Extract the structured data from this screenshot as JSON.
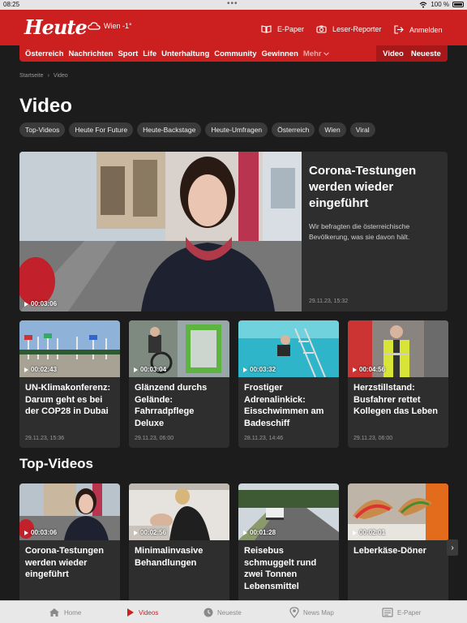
{
  "statusbar": {
    "time": "08:25",
    "battery": "100 %"
  },
  "header": {
    "logo": "Heute",
    "weather": "Wien -1°",
    "epaper": "E-Paper",
    "leser": "Leser-Reporter",
    "anmelden": "Anmelden"
  },
  "nav": {
    "items": [
      "Österreich",
      "Nachrichten",
      "Sport",
      "Life",
      "Unterhaltung",
      "Community",
      "Gewinnen"
    ],
    "more": "Mehr",
    "video": "Video",
    "neueste": "Neueste"
  },
  "breadcrumb": {
    "home": "Startseite",
    "current": "Video"
  },
  "page_title": "Video",
  "chips": [
    "Top-Videos",
    "Heute For Future",
    "Heute-Backstage",
    "Heute-Umfragen",
    "Österreich",
    "Wien",
    "Viral"
  ],
  "hero": {
    "title": "Corona-Testungen werden wieder eingeführt",
    "desc": "Wir befragten die österreichische Bevölkerung, was sie davon hält.",
    "date": "29.11.23, 15:32",
    "duration": "00:03:06"
  },
  "row1": [
    {
      "title": "UN-Klimakonferenz: Darum geht es bei der COP28 in Dubai",
      "date": "29.11.23, 15:36",
      "duration": "00:02:43"
    },
    {
      "title": "Glänzend durchs Gelände: Fahrradpflege Deluxe",
      "date": "29.11.23, 06:00",
      "duration": "00:03:04"
    },
    {
      "title": "Frostiger Adrenalinkick: Eisschwimmen am Badeschiff",
      "date": "28.11.23, 14:46",
      "duration": "00:03:32"
    },
    {
      "title": "Herzstillstand: Busfahrer rettet Kollegen das Leben",
      "date": "29.11.23, 06:00",
      "duration": "00:04:56"
    }
  ],
  "section_top": "Top-Videos",
  "row2": [
    {
      "title": "Corona-Testungen werden wieder eingeführt",
      "duration": "00:03:06"
    },
    {
      "title": "Minimalinvasive Behandlungen",
      "duration": "00:02:56"
    },
    {
      "title": "Reisebus schmuggelt rund zwei Tonnen Lebensmittel",
      "duration": "00:01:28"
    },
    {
      "title": "Leberkäse-Döner",
      "duration": "00:02:01"
    }
  ],
  "tabbar": [
    {
      "label": "Home",
      "icon": "home-icon"
    },
    {
      "label": "Videos",
      "icon": "play-icon"
    },
    {
      "label": "Neueste",
      "icon": "clock-icon"
    },
    {
      "label": "News Map",
      "icon": "map-pin-icon"
    },
    {
      "label": "E-Paper",
      "icon": "newspaper-icon"
    }
  ],
  "colors": {
    "brand": "#cc1f1f",
    "background": "#1c1c1c",
    "card": "#2e2e2e"
  }
}
